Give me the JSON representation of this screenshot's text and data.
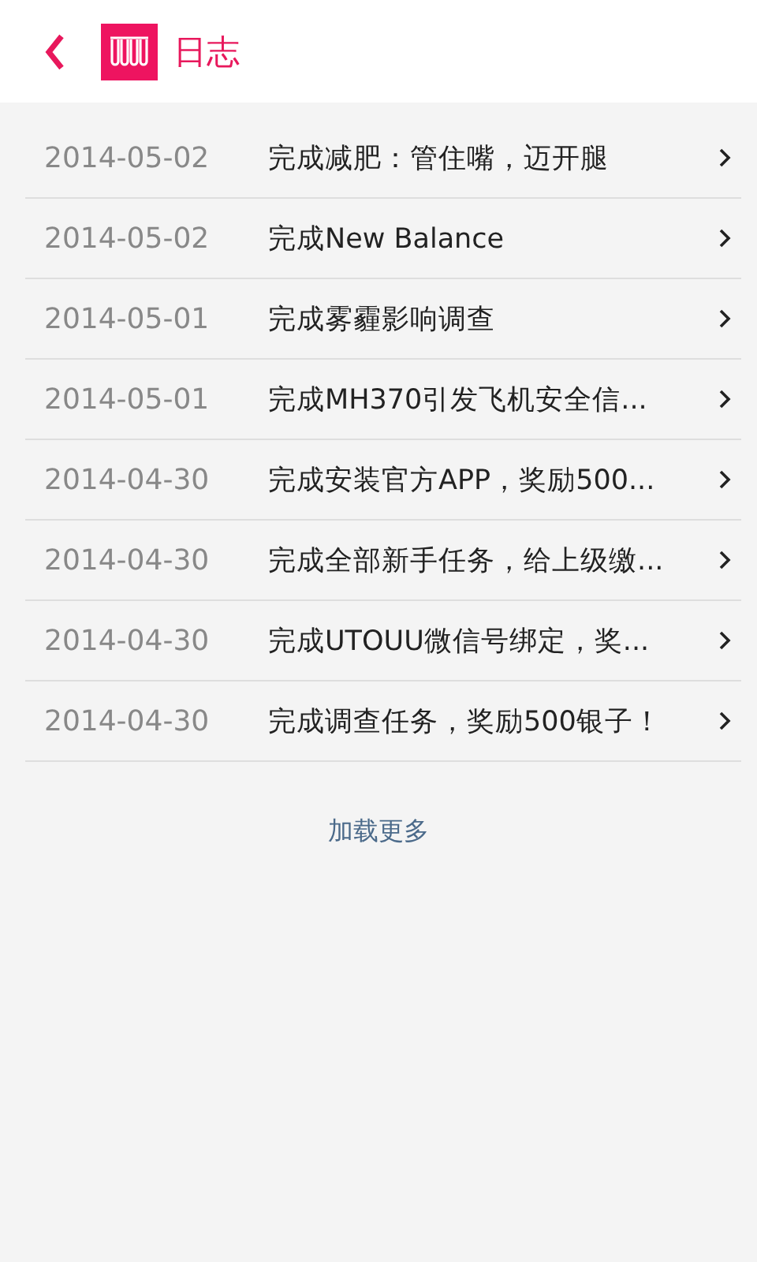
{
  "header": {
    "title": "日志"
  },
  "log": [
    {
      "date": "2014-05-02",
      "text": "完成减肥：管住嘴，迈开腿"
    },
    {
      "date": "2014-05-02",
      "text": "完成New Balance"
    },
    {
      "date": "2014-05-01",
      "text": "完成雾霾影响调查"
    },
    {
      "date": "2014-05-01",
      "text": "完成MH370引发飞机安全信..."
    },
    {
      "date": "2014-04-30",
      "text": "完成安装官方APP，奖励500..."
    },
    {
      "date": "2014-04-30",
      "text": "完成全部新手任务，给上级缴..."
    },
    {
      "date": "2014-04-30",
      "text": "完成UTOUU微信号绑定，奖..."
    },
    {
      "date": "2014-04-30",
      "text": "完成调查任务，奖励500银子！"
    }
  ],
  "load_more": "加载更多"
}
